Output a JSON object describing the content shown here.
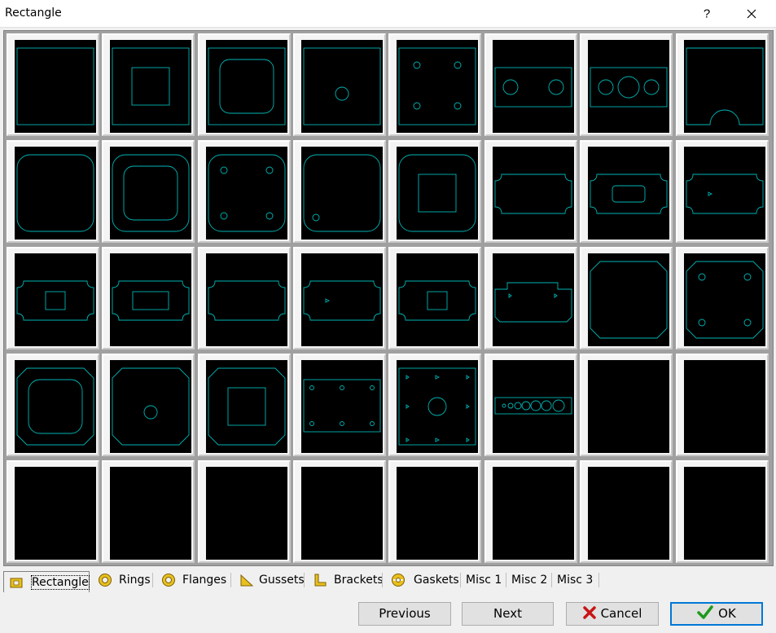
{
  "window": {
    "title": "Rectangle",
    "help_label": "?",
    "close_label": "✕"
  },
  "tabs": [
    {
      "label": "Rectangle",
      "icon": "rectangle-icon",
      "active": true
    },
    {
      "label": "Rings",
      "icon": "ring-icon"
    },
    {
      "label": "Flanges",
      "icon": "flange-icon"
    },
    {
      "label": "Gussets",
      "icon": "gusset-icon"
    },
    {
      "label": "Brackets",
      "icon": "bracket-icon"
    },
    {
      "label": "Gaskets",
      "icon": "gasket-icon"
    },
    {
      "label": "Misc 1"
    },
    {
      "label": "Misc 2"
    },
    {
      "label": "Misc 3"
    }
  ],
  "buttons": {
    "previous": "Previous",
    "next": "Next",
    "cancel": "Cancel",
    "ok": "OK"
  },
  "colors": {
    "shape_stroke": "#00b4b4",
    "preview_bg": "#000000",
    "ok_check": "#1c9a1c",
    "cancel_x": "#c81414",
    "tab_icon": "#e8c020"
  },
  "shapes": [
    "rect-plain",
    "rect-square-cutout",
    "rect-rounded-cutout",
    "rect-center-hole",
    "rect-four-holes",
    "rect-two-holes",
    "rect-three-holes",
    "rect-arch-notch",
    "rounded-rect",
    "rounded-rect-cutout",
    "rounded-rect-four-holes",
    "rounded-rect-one-hole",
    "rounded-rect-square-cutout",
    "notched-panel",
    "notched-panel-slot",
    "notched-panel-small",
    "notched-square-cutout",
    "notched-rect-cutout",
    "notched-plain",
    "notched-tab",
    "notched-tab-square",
    "stepped-tab",
    "chamfered-square",
    "chamfered-four-holes",
    "chamfered-rounded-cutout",
    "chamfered-center-hole",
    "chamfered-square-cutout",
    "rect-six-holes",
    "rect-bolt-pattern",
    "hole-strip",
    "empty",
    "empty",
    "empty",
    "empty",
    "empty",
    "empty",
    "empty",
    "empty",
    "empty",
    "empty"
  ]
}
